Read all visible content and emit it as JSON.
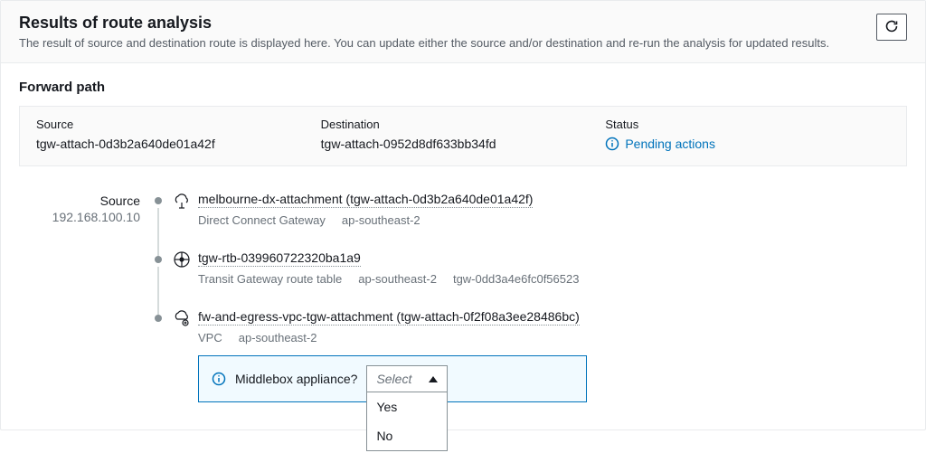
{
  "header": {
    "title": "Results of route analysis",
    "subtitle": "The result of source and destination route is displayed here. You can update either the source and/or destination and re-run the analysis for updated results."
  },
  "section": {
    "forward_path_title": "Forward path"
  },
  "summary": {
    "source_label": "Source",
    "source_value": "tgw-attach-0d3b2a640de01a42f",
    "destination_label": "Destination",
    "destination_value": "tgw-attach-0952d8df633bb34fd",
    "status_label": "Status",
    "status_value": "Pending actions"
  },
  "path_source": {
    "label": "Source",
    "ip": "192.168.100.10"
  },
  "hops": [
    {
      "title": "melbourne-dx-attachment (tgw-attach-0d3b2a640de01a42f)",
      "meta": [
        "Direct Connect Gateway",
        "ap-southeast-2"
      ]
    },
    {
      "title": "tgw-rtb-039960722320ba1a9",
      "meta": [
        "Transit Gateway route table",
        "ap-southeast-2",
        "tgw-0dd3a4e6fc0f56523"
      ]
    },
    {
      "title": "fw-and-egress-vpc-tgw-attachment (tgw-attach-0f2f08a3ee28486bc)",
      "meta": [
        "VPC",
        "ap-southeast-2"
      ]
    }
  ],
  "middlebox": {
    "label": "Middlebox appliance?",
    "placeholder": "Select",
    "options": [
      "Yes",
      "No"
    ]
  }
}
